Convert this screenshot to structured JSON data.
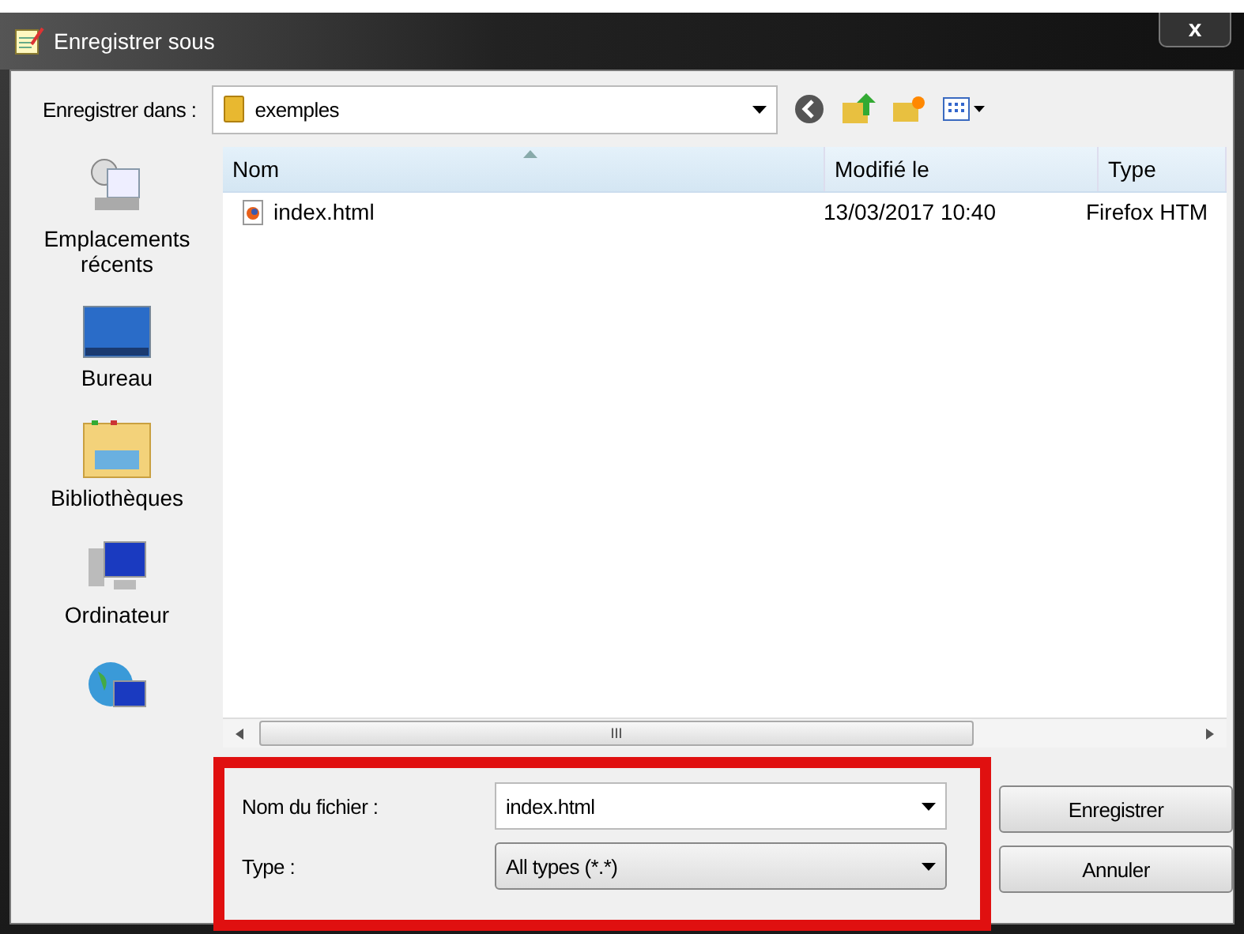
{
  "window": {
    "title": "Enregistrer sous",
    "close": "x"
  },
  "location": {
    "label": "Enregistrer dans :",
    "value": "exemples"
  },
  "sidebar": {
    "items": [
      {
        "kind": "recent",
        "label": "Emplacements récents"
      },
      {
        "kind": "desktop",
        "label": "Bureau"
      },
      {
        "kind": "libraries",
        "label": "Bibliothèques"
      },
      {
        "kind": "computer",
        "label": "Ordinateur"
      },
      {
        "kind": "network"
      }
    ]
  },
  "table": {
    "columns": [
      {
        "label": "Nom",
        "sorted": true
      },
      {
        "label": "Modifié le",
        "sorted": false
      },
      {
        "label": "Type",
        "sorted": false
      }
    ],
    "rows": [
      {
        "cells": [
          "index.html",
          "13/03/2017 10:40",
          "Firefox HTM"
        ]
      }
    ]
  },
  "scrollbar": {
    "grip": "III"
  },
  "filename": {
    "label": "Nom du fichier :",
    "value": "index.html"
  },
  "filetype": {
    "label": "Type :",
    "value": "All types (*.*)"
  },
  "buttons": [
    "Enregistrer",
    "Annuler"
  ]
}
